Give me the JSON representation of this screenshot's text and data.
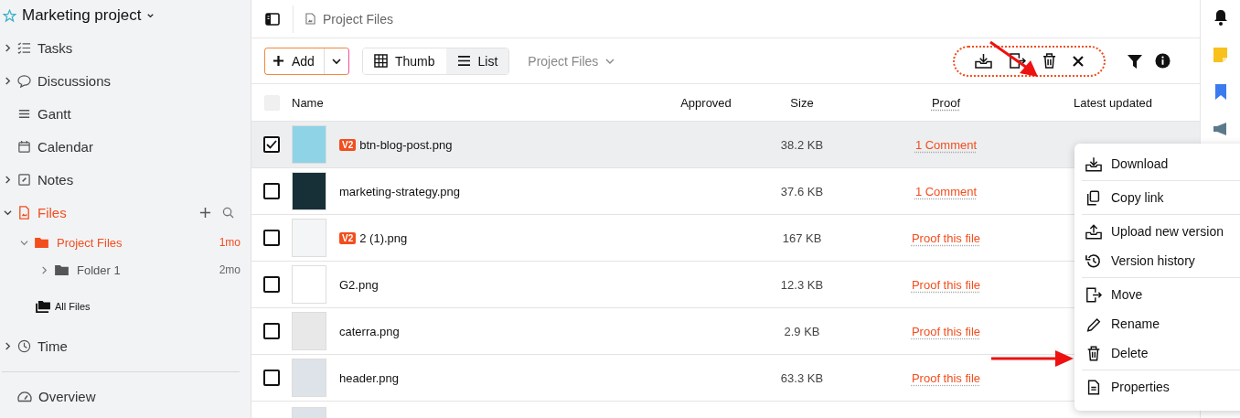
{
  "project": {
    "title": "Marketing project"
  },
  "sidebar": {
    "items": [
      {
        "label": "Tasks",
        "kind": "expandable",
        "expanded": false,
        "selected": false
      },
      {
        "label": "Discussions",
        "kind": "expandable",
        "expanded": false,
        "selected": false
      },
      {
        "label": "Gantt",
        "kind": "plain",
        "selected": false
      },
      {
        "label": "Calendar",
        "kind": "plain",
        "selected": false
      },
      {
        "label": "Notes",
        "kind": "expandable",
        "expanded": false,
        "selected": false
      },
      {
        "label": "Files",
        "kind": "expandable",
        "expanded": true,
        "selected": true,
        "children": [
          {
            "label": "Project Files",
            "age": "1mo",
            "expanded": true,
            "selected": true,
            "children": [
              {
                "label": "Folder 1",
                "age": "2mo",
                "expanded": false,
                "selected": false
              }
            ]
          }
        ],
        "extra": {
          "label": "All Files"
        }
      },
      {
        "label": "Time",
        "kind": "expandable",
        "expanded": false,
        "selected": false
      }
    ],
    "footer": {
      "label": "Overview"
    }
  },
  "breadcrumb": {
    "label": "Project Files"
  },
  "toolbar": {
    "add": "Add",
    "views": [
      {
        "label": "Thumb",
        "selected": false
      },
      {
        "label": "List",
        "selected": true
      }
    ],
    "folder": "Project Files"
  },
  "table": {
    "columns": [
      "Name",
      "Approved",
      "Size",
      "Proof",
      "Latest updated"
    ],
    "header_checkbox": {
      "disabled": true
    },
    "rows": [
      {
        "selected": true,
        "badge": "V2",
        "name": "btn-blog-post.png",
        "size": "38.2 KB",
        "proof": "1 Comment"
      },
      {
        "selected": false,
        "name": "marketing-strategy.png",
        "size": "37.6 KB",
        "proof": "1 Comment"
      },
      {
        "selected": false,
        "badge": "V2",
        "name": "2 (1).png",
        "size": "167 KB",
        "proof": "Proof this file"
      },
      {
        "selected": false,
        "name": "G2.png",
        "size": "12.3 KB",
        "proof": "Proof this file"
      },
      {
        "selected": false,
        "name": "caterra.png",
        "size": "2.9 KB",
        "proof": "Proof this file"
      },
      {
        "selected": false,
        "name": "header.png",
        "size": "63.3 KB",
        "proof": "Proof this file"
      }
    ]
  },
  "context_menu": {
    "groups": [
      [
        "Download"
      ],
      [
        "Copy link"
      ],
      [
        "Upload new version",
        "Version history"
      ],
      [
        "Move",
        "Rename",
        "Delete"
      ],
      [
        "Properties"
      ]
    ]
  }
}
